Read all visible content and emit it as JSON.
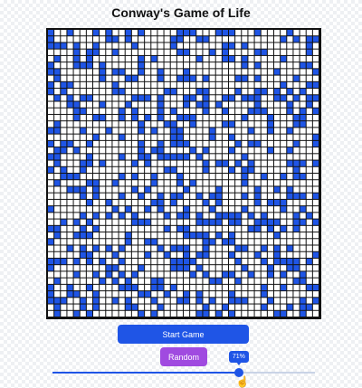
{
  "page": {
    "title": "Conway's Game of Life"
  },
  "board": {
    "cols": 42,
    "rows": 44,
    "live_color": "#1f55e6",
    "dead_color": "#ffffff",
    "grid_color": "#111111"
  },
  "controls": {
    "start_label": "Start Game",
    "random_label": "Random",
    "speed_percent": 71,
    "speed_label": "71%"
  },
  "colors": {
    "primary": "#1f55e6",
    "random_button": "#a04ae0"
  }
}
